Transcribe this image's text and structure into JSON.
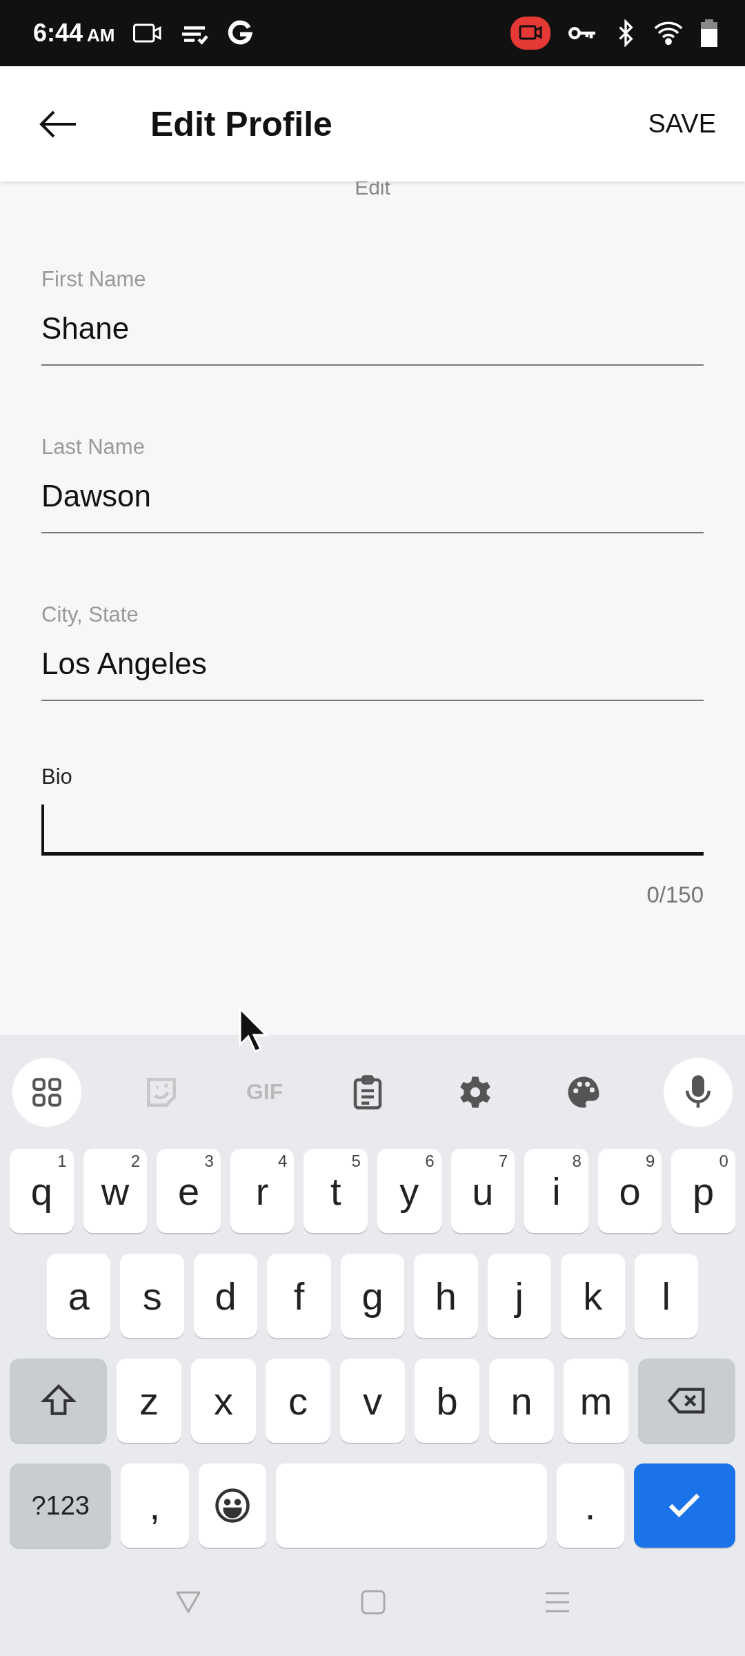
{
  "status_bar": {
    "time": "6:44",
    "ampm": "AM"
  },
  "app_bar": {
    "title": "Edit Profile",
    "action": "SAVE"
  },
  "section_caption": "Edit",
  "fields": [
    {
      "label": "First Name",
      "value": "Shane",
      "focused": false
    },
    {
      "label": "Last Name",
      "value": "Dawson",
      "focused": false
    },
    {
      "label": "City, State",
      "value": "Los Angeles",
      "focused": false
    },
    {
      "label": "Bio",
      "focused": true
    }
  ],
  "counter": "0/150",
  "keyboard": {
    "toolbar": [
      {
        "kind": "apps",
        "disabled": false
      },
      {
        "kind": "sticker",
        "disabled": true
      },
      {
        "kind": "gif",
        "label": "GIF",
        "disabled": true
      },
      {
        "kind": "clipboard",
        "disabled": false
      },
      {
        "kind": "settings",
        "disabled": false
      },
      {
        "kind": "palette",
        "disabled": false
      },
      {
        "kind": "mic",
        "disabled": false
      }
    ],
    "top_row": [
      {
        "kind": "letter",
        "label": "q",
        "hint": "1"
      },
      {
        "kind": "letter",
        "label": "w",
        "hint": "2"
      },
      {
        "kind": "letter",
        "label": "e",
        "hint": "3"
      },
      {
        "kind": "letter",
        "label": "r",
        "hint": "4"
      },
      {
        "kind": "letter",
        "label": "t",
        "hint": "5"
      },
      {
        "kind": "letter",
        "label": "y",
        "hint": "6"
      },
      {
        "kind": "letter",
        "label": "u",
        "hint": "7"
      },
      {
        "kind": "letter",
        "label": "i",
        "hint": "8"
      },
      {
        "kind": "letter",
        "label": "o",
        "hint": "9"
      },
      {
        "kind": "letter",
        "label": "p",
        "hint": "0"
      }
    ],
    "home_row": [
      {
        "kind": "letter",
        "label": "a"
      },
      {
        "kind": "letter",
        "label": "s"
      },
      {
        "kind": "letter",
        "label": "d"
      },
      {
        "kind": "letter",
        "label": "f"
      },
      {
        "kind": "letter",
        "label": "g"
      },
      {
        "kind": "letter",
        "label": "h"
      },
      {
        "kind": "letter",
        "label": "j"
      },
      {
        "kind": "letter",
        "label": "k"
      },
      {
        "kind": "letter",
        "label": "l"
      }
    ],
    "lower_row": [
      {
        "kind": "shift"
      },
      {
        "kind": "letter",
        "label": "z"
      },
      {
        "kind": "letter",
        "label": "x"
      },
      {
        "kind": "letter",
        "label": "c"
      },
      {
        "kind": "letter",
        "label": "v"
      },
      {
        "kind": "letter",
        "label": "b"
      },
      {
        "kind": "letter",
        "label": "n"
      },
      {
        "kind": "letter",
        "label": "m"
      },
      {
        "kind": "backspace"
      }
    ],
    "function_row": [
      {
        "kind": "symbols",
        "label": "?123"
      },
      {
        "kind": "letter",
        "label": ","
      },
      {
        "kind": "emoji"
      },
      {
        "kind": "space"
      },
      {
        "kind": "letter",
        "label": "."
      },
      {
        "kind": "done"
      }
    ]
  }
}
